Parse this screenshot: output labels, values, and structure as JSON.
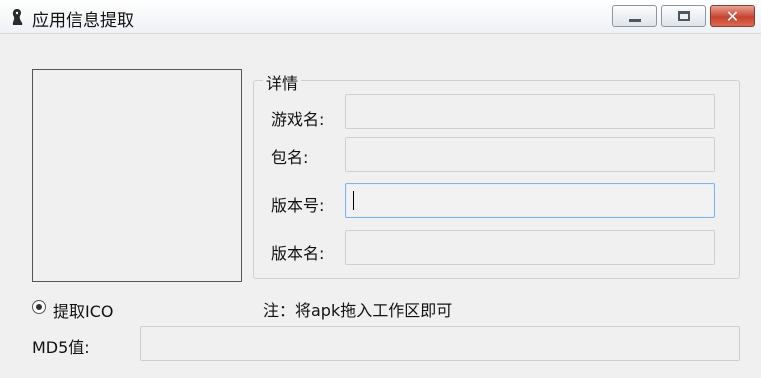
{
  "window": {
    "title": "应用信息提取",
    "close_glyph": "✕"
  },
  "details": {
    "group_title": "详情",
    "fields": [
      {
        "label": "游戏名:",
        "value": ""
      },
      {
        "label": "包名:",
        "value": ""
      },
      {
        "label": "版本号:",
        "value": ""
      },
      {
        "label": "版本名:",
        "value": ""
      }
    ]
  },
  "options": {
    "extract_ico_label": "提取ICO",
    "extract_ico_checked": true
  },
  "note": "注：将apk拖入工作区即可",
  "md5": {
    "label": "MD5值:",
    "value": ""
  }
}
